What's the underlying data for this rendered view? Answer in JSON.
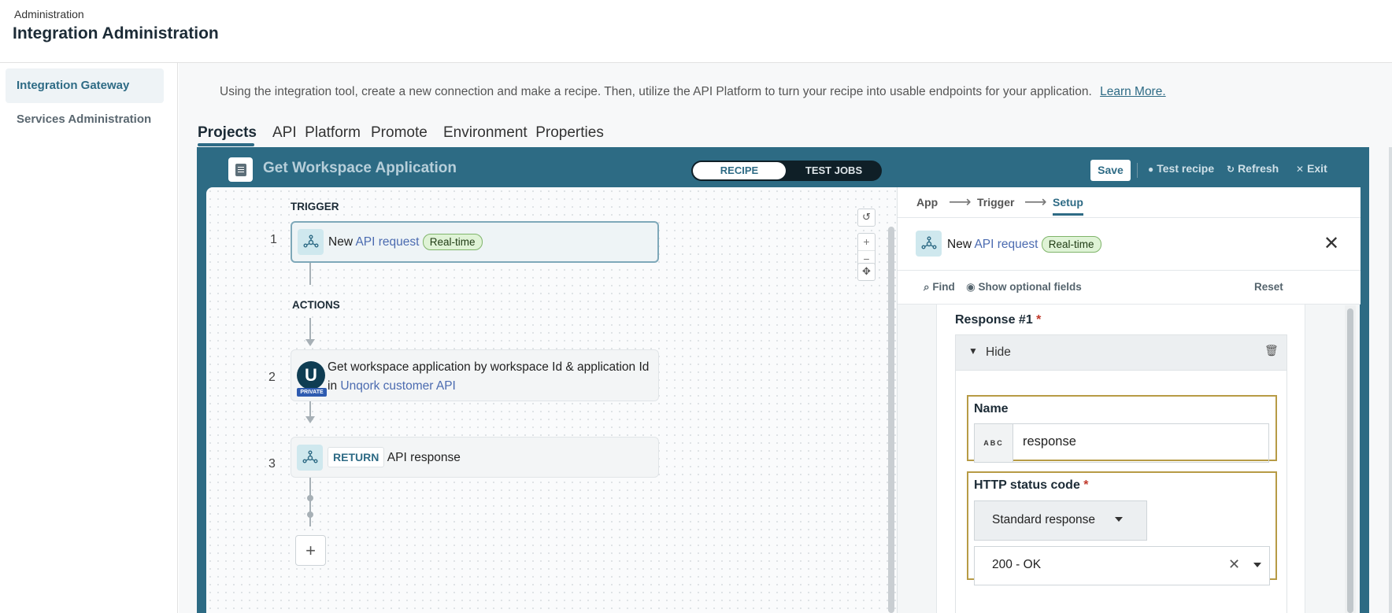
{
  "header": {
    "breadcrumb": "Administration",
    "title": "Integration Administration"
  },
  "sidebar": {
    "items": [
      {
        "label": "Integration Gateway",
        "active": true
      },
      {
        "label": "Services Administration",
        "active": false
      }
    ]
  },
  "intro": {
    "text": "Using the integration tool, create a new connection and make a recipe. Then, utilize the API Platform to turn your recipe into usable endpoints for your application.",
    "link": "Learn More."
  },
  "tabs": [
    {
      "label": "Projects",
      "active": true
    },
    {
      "label": "API  Platform"
    },
    {
      "label": "Promote"
    },
    {
      "label": "Environment  Properties"
    }
  ],
  "recipe": {
    "title": "Get Workspace Application",
    "toggle": {
      "on": "RECIPE",
      "off": "TEST JOBS"
    },
    "save": "Save",
    "actions": {
      "test": "Test recipe",
      "refresh": "Refresh",
      "exit": "Exit"
    }
  },
  "canvas": {
    "trigger_label": "TRIGGER",
    "actions_label": "ACTIONS",
    "steps": [
      {
        "num": "1",
        "prefix": "New",
        "link": "API request",
        "badge": "Real-time"
      },
      {
        "num": "2",
        "text": "Get workspace application by workspace Id & application Id in",
        "link": "Unqork customer API",
        "badge_letter": "U",
        "badge_tag": "PRIVATE"
      },
      {
        "num": "3",
        "chip": "RETURN",
        "text": "API response"
      }
    ]
  },
  "panel": {
    "crumbs": [
      "App",
      "Trigger",
      "Setup"
    ],
    "trigger": {
      "prefix": "New",
      "link": "API request",
      "badge": "Real-time"
    },
    "tools": {
      "find": "Find",
      "optional": "Show optional fields",
      "reset": "Reset"
    },
    "response": {
      "title": "Response #1",
      "toggle": "Hide",
      "name_label": "Name",
      "name_type": "ABC",
      "name_value": "response",
      "status_label": "HTTP status code",
      "status_type": "Standard response",
      "status_value": "200 - OK"
    }
  },
  "colors": {
    "accent": "#2e6b85",
    "frame": "#2d6b84",
    "highlight": "#b79b45",
    "pill": "#dff3d6"
  }
}
